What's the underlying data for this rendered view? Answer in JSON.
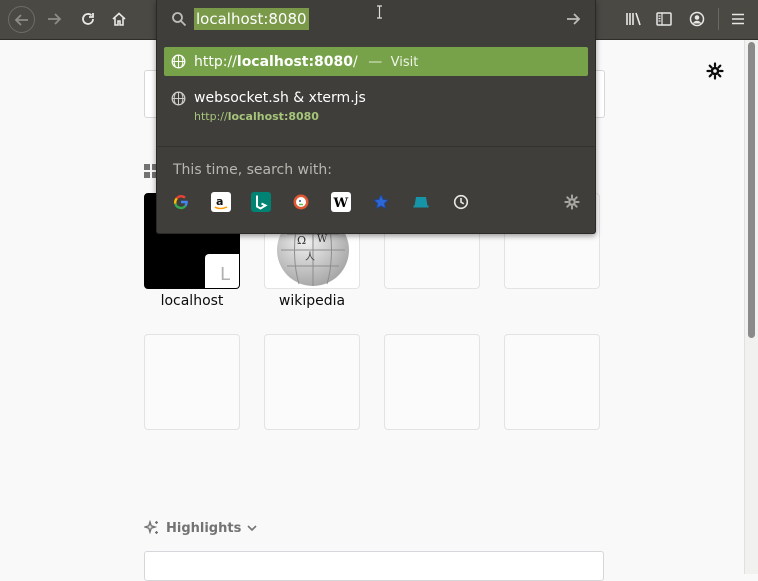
{
  "browser": {
    "nav": {
      "back_icon": "arrow-left-icon",
      "forward_icon": "arrow-right-icon",
      "reload_icon": "reload-icon",
      "home_icon": "home-icon"
    },
    "urlbar": {
      "value": "localhost:8080"
    },
    "right_icons": [
      "library-icon",
      "sidebar-icon",
      "account-icon",
      "menu-icon"
    ]
  },
  "dropdown": {
    "results": [
      {
        "url_prefix": "http://",
        "url_bold": "localhost:8080",
        "url_suffix": "/",
        "separator": "—",
        "action": "Visit",
        "selected": true
      },
      {
        "title": "websocket.sh & xterm.js",
        "url_prefix": "http://",
        "url_bold": "localhost:8080"
      }
    ],
    "search_with_label": "This time, search with:",
    "engines": [
      "google-icon",
      "amazon-icon",
      "bing-icon",
      "duckduckgo-icon",
      "wikipedia-icon",
      "bookmark-star-icon",
      "tabs-icon",
      "history-icon"
    ]
  },
  "newtab": {
    "top_sites": [
      {
        "label": "localhost",
        "letter": "L"
      },
      {
        "label": "wikipedia"
      }
    ],
    "highlights_label": "Highlights"
  },
  "colors": {
    "toolbar": "#4a4944",
    "panel": "#3f3e3a",
    "selected_row": "#77a24a",
    "url_green": "#a6c57a"
  }
}
